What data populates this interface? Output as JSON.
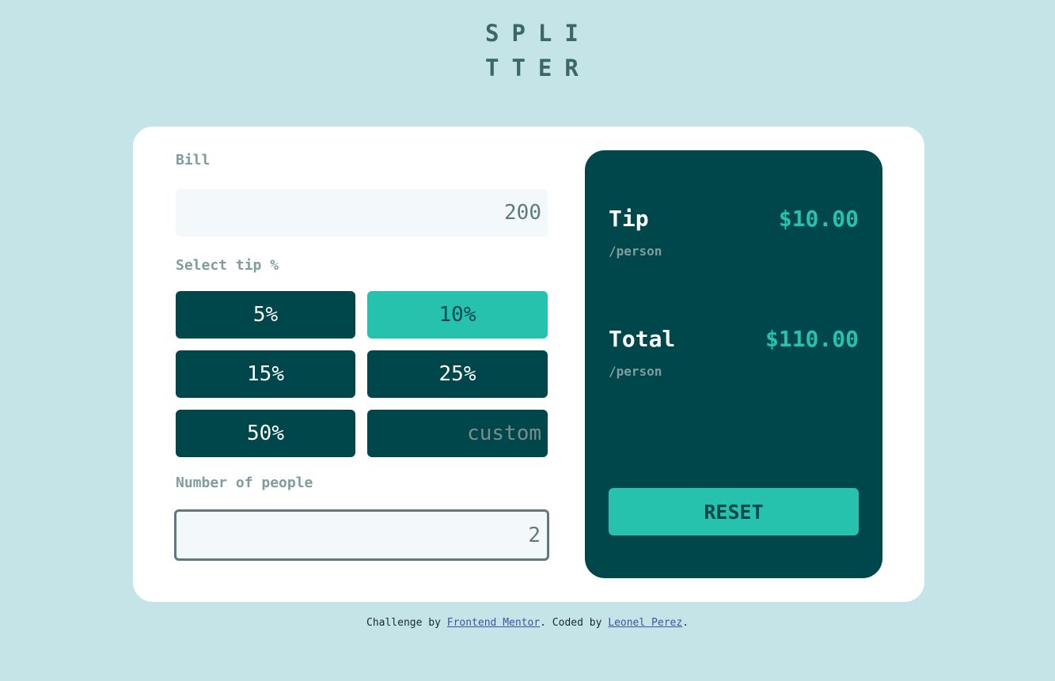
{
  "logo": {
    "line1": "SPLI",
    "line2": "TTER"
  },
  "bill": {
    "label": "Bill",
    "value": "200"
  },
  "tip": {
    "label": "Select tip %",
    "options": [
      "5%",
      "10%",
      "15%",
      "25%",
      "50%"
    ],
    "selected": "10%",
    "custom_placeholder": "custom"
  },
  "people": {
    "label": "Number of people",
    "value": "2"
  },
  "results": {
    "tip_title": "Tip",
    "tip_sub": "/person",
    "tip_amount": "$10.00",
    "total_title": "Total",
    "total_sub": "/person",
    "total_amount": "$110.00",
    "reset_label": "RESET"
  },
  "footer": {
    "prefix": "Challenge by ",
    "link1": "Frontend Mentor",
    "middle": ". Coded by ",
    "link2": "Leonel Perez",
    "suffix": "."
  },
  "colors": {
    "background": "#c5e4e7",
    "dark_cyan": "#00474b",
    "strong_cyan": "#26c2ae",
    "card": "#ffffff"
  }
}
